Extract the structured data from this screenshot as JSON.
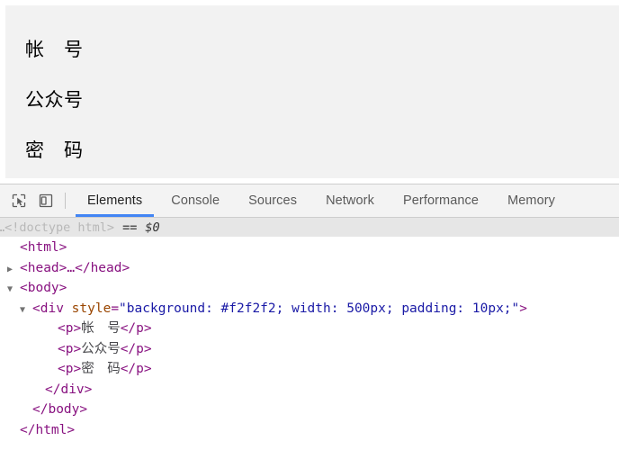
{
  "page": {
    "div_style": "background: #f2f2f2; width: 500px; padding: 10px;",
    "lines": [
      "帐　号",
      "公众号",
      "密　码"
    ]
  },
  "devtools": {
    "toolbar": {
      "inspect_icon": "inspect-element-icon",
      "device_icon": "device-toolbar-icon"
    },
    "tabs": [
      {
        "label": "Elements",
        "active": true
      },
      {
        "label": "Console",
        "active": false
      },
      {
        "label": "Sources",
        "active": false
      },
      {
        "label": "Network",
        "active": false
      },
      {
        "label": "Performance",
        "active": false
      },
      {
        "label": "Memory",
        "active": false
      }
    ],
    "accent_color": "#4285f4",
    "crumb": {
      "ellipsis": "…",
      "doctype": "<!doctype html>",
      "equals": "==",
      "selected_ref": "$0"
    },
    "dom": {
      "html_open": "<html>",
      "head_line": "<head>…</head>",
      "body_open": "<body>",
      "div_tag_open": "<div",
      "div_attr_name": "style",
      "div_attr_value": "\"background: #f2f2f2; width: 500px; padding: 10px;\"",
      "div_tag_close_bracket": ">",
      "p_open": "<p>",
      "p_close": "</p>",
      "p1_text": "帐　号",
      "p2_text": "公众号",
      "p3_text": "密　码",
      "div_close": "</div>",
      "body_close": "</body>",
      "html_close": "</html>",
      "triangle_collapsed": "▶",
      "triangle_expanded": "▼"
    }
  }
}
